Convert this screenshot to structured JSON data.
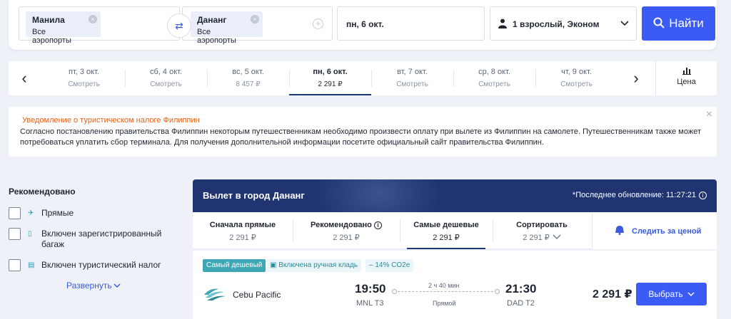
{
  "search": {
    "origin_city": "Манила",
    "origin_sub": "Все аэропорты",
    "dest_city": "Дананг",
    "dest_sub": "Все аэропорты",
    "date": "пн, 6 окт.",
    "passengers": "1 взрослый, Эконом",
    "search_label": "Найти"
  },
  "dates": [
    {
      "day": "пт, 3 окт.",
      "price": "Смотреть"
    },
    {
      "day": "сб, 4 окт.",
      "price": "Смотреть"
    },
    {
      "day": "вс, 5 окт.",
      "price": "8 457 ₽"
    },
    {
      "day": "пн, 6 окт.",
      "price": "2 291 ₽"
    },
    {
      "day": "вт, 7 окт.",
      "price": "Смотреть"
    },
    {
      "day": "ср, 8 окт.",
      "price": "Смотреть"
    },
    {
      "day": "чт, 9 окт.",
      "price": "Смотреть"
    }
  ],
  "price_label": "Цена",
  "notice": {
    "title": "Уведомление о туристическом налоге Филиппин",
    "body": "Согласно постановлению правительства Филиппин некоторым путешественникам необходимо произвести оплату при вылете из Филиппин на самолете. Путешественникам также может потребоваться уплатить сбор терминала. Для получения дополнительной информации посетите официальный сайт правительства Филиппин."
  },
  "sidebar": {
    "title": "Рекомендовано",
    "filters": [
      "Прямые",
      "Включен зарегистрированный багаж",
      "Включен туристический налог"
    ],
    "expand": "Развернуть"
  },
  "results": {
    "heading": "Вылет в город Дананг",
    "updated": "*Последнее обновление: 11:27:21"
  },
  "sort": [
    {
      "label": "Сначала прямые",
      "price": "2 291 ₽"
    },
    {
      "label": "Рекомендовано",
      "price": "2 291 ₽"
    },
    {
      "label": "Самые дешевые",
      "price": "2 291 ₽"
    },
    {
      "label": "Сортировать",
      "price": "2 291 ₽"
    }
  ],
  "track_label": "Следить за ценой",
  "flight": {
    "badge_cheapest": "Самый дешевый",
    "badge_bag": "Включена ручная кладь",
    "badge_co2": "– 14% CO2e",
    "airline": "Cebu Pacific",
    "dep_time": "19:50",
    "dep_code": "MNL T3",
    "duration": "2 ч 40 мин",
    "stops": "Прямой",
    "arr_time": "21:30",
    "arr_code": "DAD T2",
    "price": "2 291 ₽",
    "choose_label": "Выбрать"
  },
  "colors": {
    "accent": "#3b5bf5",
    "header_bg": "#1f3470",
    "notice_title": "#e0641c",
    "teal": "#3ea6b4"
  }
}
